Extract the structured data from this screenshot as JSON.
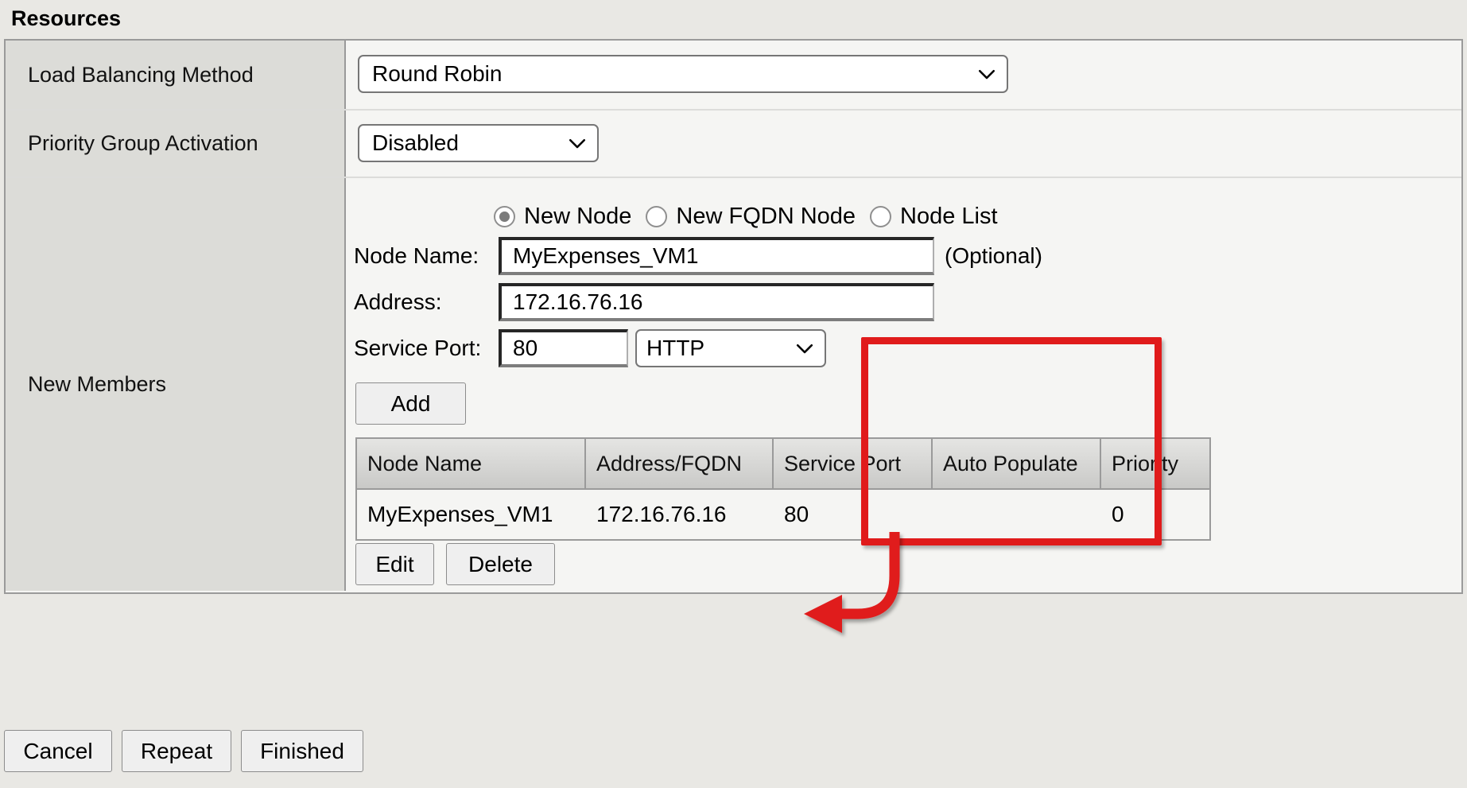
{
  "section": {
    "title": "Resources"
  },
  "rows": {
    "load_balancing": {
      "label": "Load Balancing Method",
      "value": "Round Robin"
    },
    "priority_group": {
      "label": "Priority Group Activation",
      "value": "Disabled"
    },
    "new_members": {
      "label": "New Members"
    }
  },
  "member_form": {
    "radios": [
      {
        "label": "New Node",
        "selected": true
      },
      {
        "label": "New FQDN Node",
        "selected": false
      },
      {
        "label": "Node List",
        "selected": false
      }
    ],
    "node_name_label": "Node Name:",
    "node_name_value": "MyExpenses_VM1",
    "node_name_hint": "(Optional)",
    "address_label": "Address:",
    "address_value": "172.16.76.16",
    "service_port_label": "Service Port:",
    "service_port_value": "80",
    "service_protocol_value": "HTTP",
    "add_label": "Add",
    "edit_label": "Edit",
    "delete_label": "Delete"
  },
  "members_table": {
    "columns": [
      "Node Name",
      "Address/FQDN",
      "Service Port",
      "Auto Populate",
      "Priority"
    ],
    "rows": [
      {
        "node_name": "MyExpenses_VM1",
        "address": "172.16.76.16",
        "service_port": "80",
        "auto_populate": "",
        "priority": "0"
      }
    ]
  },
  "footer": {
    "cancel_label": "Cancel",
    "repeat_label": "Repeat",
    "finished_label": "Finished"
  },
  "annotation": {
    "highlight_color": "#e01b1b"
  }
}
